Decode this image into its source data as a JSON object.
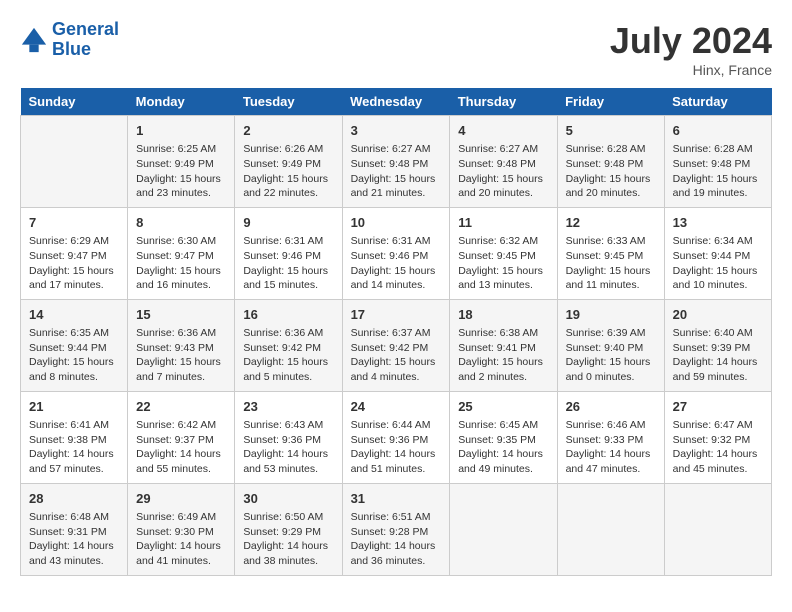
{
  "header": {
    "logo_line1": "General",
    "logo_line2": "Blue",
    "month_title": "July 2024",
    "subtitle": "Hinx, France"
  },
  "weekdays": [
    "Sunday",
    "Monday",
    "Tuesday",
    "Wednesday",
    "Thursday",
    "Friday",
    "Saturday"
  ],
  "weeks": [
    [
      {
        "day": "",
        "info": ""
      },
      {
        "day": "1",
        "info": "Sunrise: 6:25 AM\nSunset: 9:49 PM\nDaylight: 15 hours\nand 23 minutes."
      },
      {
        "day": "2",
        "info": "Sunrise: 6:26 AM\nSunset: 9:49 PM\nDaylight: 15 hours\nand 22 minutes."
      },
      {
        "day": "3",
        "info": "Sunrise: 6:27 AM\nSunset: 9:48 PM\nDaylight: 15 hours\nand 21 minutes."
      },
      {
        "day": "4",
        "info": "Sunrise: 6:27 AM\nSunset: 9:48 PM\nDaylight: 15 hours\nand 20 minutes."
      },
      {
        "day": "5",
        "info": "Sunrise: 6:28 AM\nSunset: 9:48 PM\nDaylight: 15 hours\nand 20 minutes."
      },
      {
        "day": "6",
        "info": "Sunrise: 6:28 AM\nSunset: 9:48 PM\nDaylight: 15 hours\nand 19 minutes."
      }
    ],
    [
      {
        "day": "7",
        "info": "Sunrise: 6:29 AM\nSunset: 9:47 PM\nDaylight: 15 hours\nand 17 minutes."
      },
      {
        "day": "8",
        "info": "Sunrise: 6:30 AM\nSunset: 9:47 PM\nDaylight: 15 hours\nand 16 minutes."
      },
      {
        "day": "9",
        "info": "Sunrise: 6:31 AM\nSunset: 9:46 PM\nDaylight: 15 hours\nand 15 minutes."
      },
      {
        "day": "10",
        "info": "Sunrise: 6:31 AM\nSunset: 9:46 PM\nDaylight: 15 hours\nand 14 minutes."
      },
      {
        "day": "11",
        "info": "Sunrise: 6:32 AM\nSunset: 9:45 PM\nDaylight: 15 hours\nand 13 minutes."
      },
      {
        "day": "12",
        "info": "Sunrise: 6:33 AM\nSunset: 9:45 PM\nDaylight: 15 hours\nand 11 minutes."
      },
      {
        "day": "13",
        "info": "Sunrise: 6:34 AM\nSunset: 9:44 PM\nDaylight: 15 hours\nand 10 minutes."
      }
    ],
    [
      {
        "day": "14",
        "info": "Sunrise: 6:35 AM\nSunset: 9:44 PM\nDaylight: 15 hours\nand 8 minutes."
      },
      {
        "day": "15",
        "info": "Sunrise: 6:36 AM\nSunset: 9:43 PM\nDaylight: 15 hours\nand 7 minutes."
      },
      {
        "day": "16",
        "info": "Sunrise: 6:36 AM\nSunset: 9:42 PM\nDaylight: 15 hours\nand 5 minutes."
      },
      {
        "day": "17",
        "info": "Sunrise: 6:37 AM\nSunset: 9:42 PM\nDaylight: 15 hours\nand 4 minutes."
      },
      {
        "day": "18",
        "info": "Sunrise: 6:38 AM\nSunset: 9:41 PM\nDaylight: 15 hours\nand 2 minutes."
      },
      {
        "day": "19",
        "info": "Sunrise: 6:39 AM\nSunset: 9:40 PM\nDaylight: 15 hours\nand 0 minutes."
      },
      {
        "day": "20",
        "info": "Sunrise: 6:40 AM\nSunset: 9:39 PM\nDaylight: 14 hours\nand 59 minutes."
      }
    ],
    [
      {
        "day": "21",
        "info": "Sunrise: 6:41 AM\nSunset: 9:38 PM\nDaylight: 14 hours\nand 57 minutes."
      },
      {
        "day": "22",
        "info": "Sunrise: 6:42 AM\nSunset: 9:37 PM\nDaylight: 14 hours\nand 55 minutes."
      },
      {
        "day": "23",
        "info": "Sunrise: 6:43 AM\nSunset: 9:36 PM\nDaylight: 14 hours\nand 53 minutes."
      },
      {
        "day": "24",
        "info": "Sunrise: 6:44 AM\nSunset: 9:36 PM\nDaylight: 14 hours\nand 51 minutes."
      },
      {
        "day": "25",
        "info": "Sunrise: 6:45 AM\nSunset: 9:35 PM\nDaylight: 14 hours\nand 49 minutes."
      },
      {
        "day": "26",
        "info": "Sunrise: 6:46 AM\nSunset: 9:33 PM\nDaylight: 14 hours\nand 47 minutes."
      },
      {
        "day": "27",
        "info": "Sunrise: 6:47 AM\nSunset: 9:32 PM\nDaylight: 14 hours\nand 45 minutes."
      }
    ],
    [
      {
        "day": "28",
        "info": "Sunrise: 6:48 AM\nSunset: 9:31 PM\nDaylight: 14 hours\nand 43 minutes."
      },
      {
        "day": "29",
        "info": "Sunrise: 6:49 AM\nSunset: 9:30 PM\nDaylight: 14 hours\nand 41 minutes."
      },
      {
        "day": "30",
        "info": "Sunrise: 6:50 AM\nSunset: 9:29 PM\nDaylight: 14 hours\nand 38 minutes."
      },
      {
        "day": "31",
        "info": "Sunrise: 6:51 AM\nSunset: 9:28 PM\nDaylight: 14 hours\nand 36 minutes."
      },
      {
        "day": "",
        "info": ""
      },
      {
        "day": "",
        "info": ""
      },
      {
        "day": "",
        "info": ""
      }
    ]
  ]
}
